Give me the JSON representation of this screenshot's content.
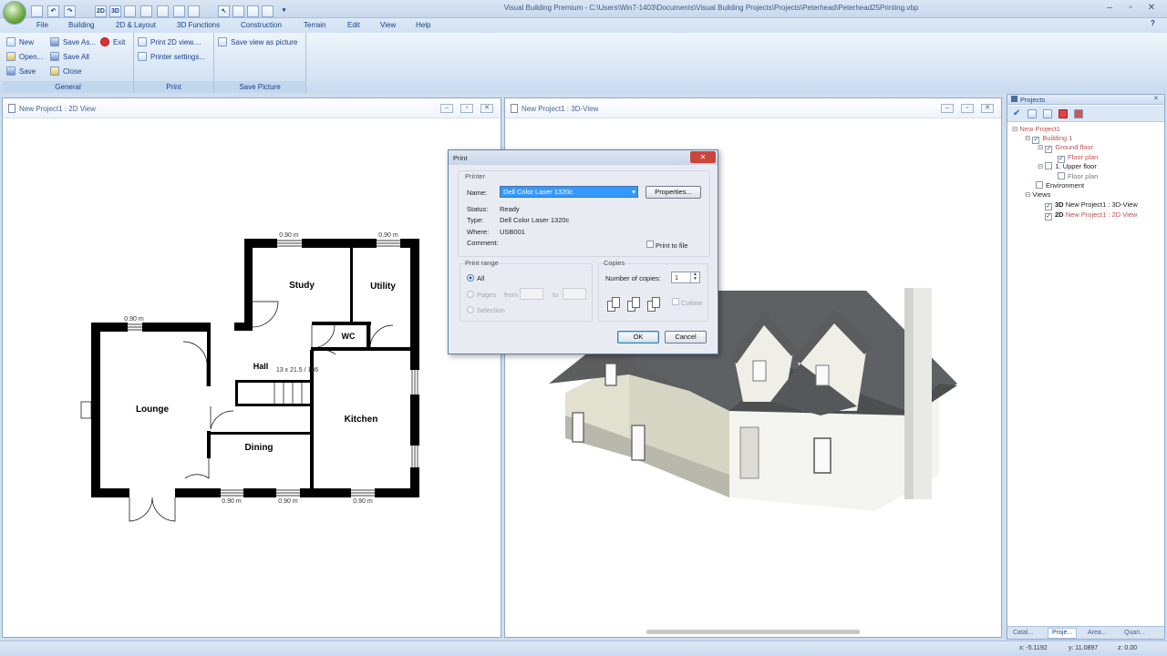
{
  "window": {
    "title": "Visual Building Premium - C:\\Users\\Win7-1403\\Documents\\Visual Building Projects\\Projects\\Peterhead\\Peterhead25Printing.vbp",
    "help_glyph": "?"
  },
  "quick_access": [
    "2D",
    "3D"
  ],
  "menu": [
    "File",
    "Building",
    "2D & Layout",
    "3D Functions",
    "Construction",
    "Terrain",
    "Edit",
    "View",
    "Help"
  ],
  "ribbon": {
    "general": {
      "caption": "General",
      "new": "New",
      "open": "Open...",
      "save": "Save",
      "save_as": "Save As...",
      "save_all": "Save All",
      "close": "Close",
      "exit": "Exit"
    },
    "print": {
      "caption": "Print",
      "print_2d": "Print 2D view....",
      "printer_settings": "Printer settings..."
    },
    "save_picture": {
      "caption": "Save Picture",
      "save_view": "Save view as picture"
    }
  },
  "view2d": {
    "title": "New Project1 : 2D View",
    "rooms": [
      "Study",
      "Utility",
      "WC",
      "Hall",
      "Lounge",
      "Kitchen",
      "Dining"
    ],
    "dimension": "13 x 21.5 / 186",
    "window_label": "0.90 m"
  },
  "view3d": {
    "title": "New Project1 : 3D-View"
  },
  "print_dialog": {
    "title": "Print",
    "close_glyph": "✕",
    "printer_group": "Printer",
    "name_label": "Name:",
    "name_value": "Dell Color Laser 1320c",
    "properties": "Properties...",
    "status_label": "Status:",
    "status_value": "Ready",
    "type_label": "Type:",
    "type_value": "Dell Color Laser 1320c",
    "where_label": "Where:",
    "where_value": "USB001",
    "comment_label": "Comment:",
    "print_to_file": "Print to file",
    "range_group": "Print range",
    "all": "All",
    "pages": "Pages",
    "from": "from",
    "to": "to",
    "selection": "Selection",
    "copies_group": "Copies",
    "num_copies_label": "Number of copies:",
    "num_copies_value": "1",
    "collate": "Collate",
    "ok": "OK",
    "cancel": "Cancel"
  },
  "projects_panel": {
    "title": "Projects",
    "tree": {
      "root": "New Project1",
      "building": "Building 1",
      "ground_floor": "Ground floor",
      "floor_plan_1": "Floor plan",
      "upper_floor": "1. Upper floor",
      "floor_plan_2": "Floor plan",
      "environment": "Environment",
      "views": "Views",
      "view_3d_tag": "3D",
      "view_3d": "New Project1 : 3D-View",
      "view_2d_tag": "2D",
      "view_2d": "New Project1 : 2D View"
    },
    "tabs": [
      "Catal...",
      "Proje...",
      "Area...",
      "Quan..."
    ]
  },
  "statusbar": {
    "x": "x: -5.1192",
    "y": "y: 11.0897",
    "z": "z: 0.00"
  }
}
